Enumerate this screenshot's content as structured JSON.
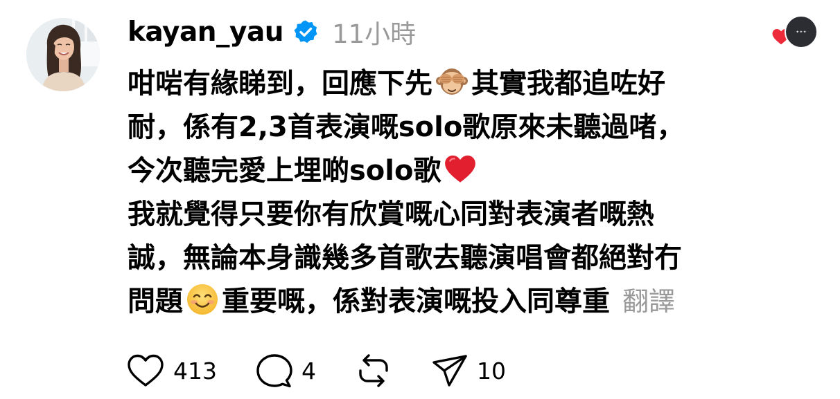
{
  "post": {
    "username": "kayan_yau",
    "timestamp": "11小時",
    "lines": {
      "l1a": "咁啱有緣睇到，回應下先",
      "l1b": "其實我都追咗好",
      "l2": "耐，係有2,3首表演嘅solo歌原來未聽過啫，",
      "l3": "今次聽完愛上埋啲solo歌",
      "l4": "我就覺得只要你有欣賞嘅心同對表演者嘅熱",
      "l5": "誠，無論本身識幾多首歌去聽演唱會都絕對冇",
      "l6a": "問題",
      "l6b": "重要嘅，係對表演嘅投入同尊重"
    },
    "translate_label": "翻譯"
  },
  "actions": {
    "likes": "413",
    "comments": "4",
    "shares": "10"
  },
  "icons": {
    "verified": "verified-badge-icon",
    "monkey": "see-no-evil-monkey-emoji",
    "heart_emoji": "red-heart-emoji",
    "smile": "smiling-face-emoji",
    "like": "heart-outline-icon",
    "comment": "comment-bubble-icon",
    "repost": "repost-icon",
    "share": "send-icon"
  },
  "colors": {
    "verified_blue": "#0095f6",
    "muted_text": "#999999",
    "heart_red": "#ed2a3a"
  }
}
